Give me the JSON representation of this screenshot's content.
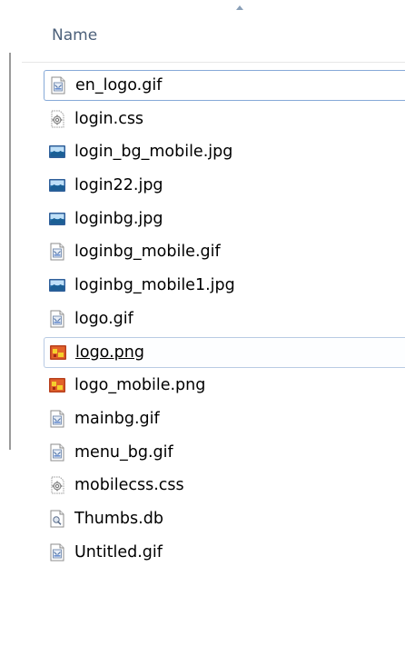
{
  "header": {
    "name_label": "Name"
  },
  "files": [
    {
      "name": "en_logo.gif",
      "icon": "gif-image-icon",
      "state": "focus"
    },
    {
      "name": "login.css",
      "icon": "css-file-icon",
      "state": ""
    },
    {
      "name": "login_bg_mobile.jpg",
      "icon": "jpg-image-icon",
      "state": ""
    },
    {
      "name": "login22.jpg",
      "icon": "jpg-image-icon",
      "state": ""
    },
    {
      "name": "loginbg.jpg",
      "icon": "jpg-image-icon",
      "state": ""
    },
    {
      "name": "loginbg_mobile.gif",
      "icon": "gif-image-icon",
      "state": ""
    },
    {
      "name": "loginbg_mobile1.jpg",
      "icon": "jpg-image-icon",
      "state": ""
    },
    {
      "name": "logo.gif",
      "icon": "gif-image-icon",
      "state": ""
    },
    {
      "name": "logo.png",
      "icon": "png-image-icon",
      "state": "hover"
    },
    {
      "name": "logo_mobile.png",
      "icon": "png-image-icon",
      "state": ""
    },
    {
      "name": "mainbg.gif",
      "icon": "gif-image-icon",
      "state": ""
    },
    {
      "name": "menu_bg.gif",
      "icon": "gif-image-icon",
      "state": ""
    },
    {
      "name": "mobilecss.css",
      "icon": "css-file-icon",
      "state": ""
    },
    {
      "name": "Thumbs.db",
      "icon": "db-file-icon",
      "state": ""
    },
    {
      "name": "Untitled.gif",
      "icon": "gif-image-icon",
      "state": ""
    }
  ]
}
